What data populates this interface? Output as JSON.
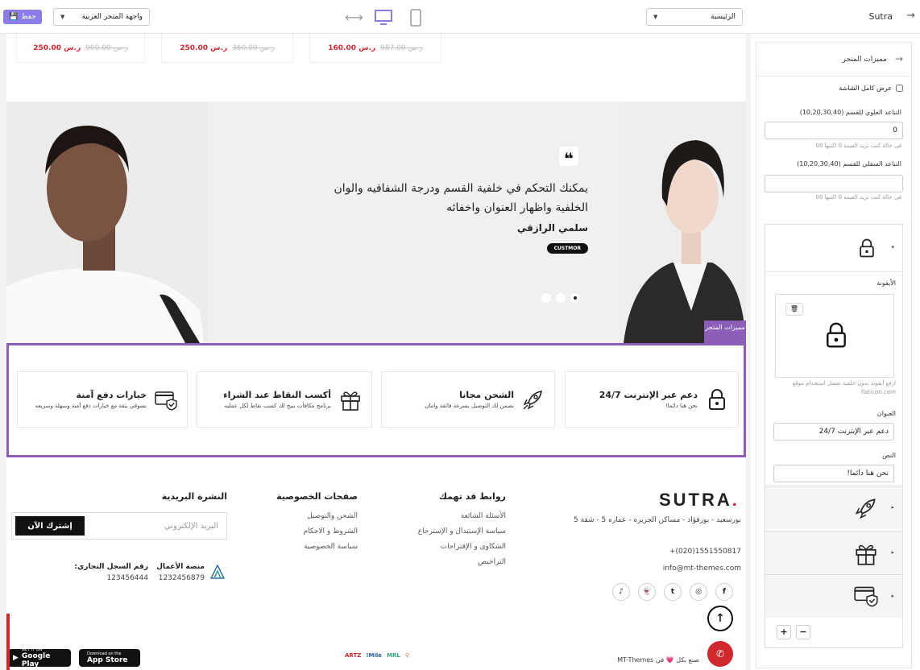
{
  "topbar": {
    "save_label": "حفظ",
    "theme_select": "واجهة المتجر العربية",
    "page_select": "الرئيسية",
    "brand": "Sutra"
  },
  "products": [
    {
      "price": "250.00 ر.س",
      "old": "900.00 ر.س"
    },
    {
      "price": "250.00 ر.س",
      "old": "360.00 ر.س"
    },
    {
      "price": "160.00 ر.س",
      "old": "987.00 ر.س"
    }
  ],
  "testimonial": {
    "quote": "يمكنك التحكم في خلفية القسم ودرجة الشفافيه والوان الخلفية واظهار العنوان واخفائه",
    "name": "سلمي الرازقي",
    "badge": "CUSTMOR",
    "tag": "مميزات المتجر"
  },
  "features": [
    {
      "title": "دعم عبر الإنترنت 24/7",
      "sub": "نحن هنا دائما!",
      "icon": "lock-icon"
    },
    {
      "title": "الشحن مجانا",
      "sub": "نضمن لك التوصيل بسرعة فائقة وامان",
      "icon": "rocket-icon"
    },
    {
      "title": "أكسب النقاط عند الشراء",
      "sub": "برنامج مكافأت بنيح لك كسب نقاط لكل عمليه",
      "icon": "gift-icon"
    },
    {
      "title": "خيارات دفع آمنة",
      "sub": "نسوقي بثقة مع خيارات دفع آمنة وسهلة وسريعه",
      "icon": "secure-card-icon"
    }
  ],
  "footer": {
    "logo": "SUTRA",
    "address": "بورسعيد - بورفؤاد - مساكن الجزيره - عماره 5 - شقة 5",
    "phone": "+(020)1551550817",
    "email": "info@mt-themes.com",
    "col1_title": "روابط قد تهمك",
    "col1_links": [
      "الأسئلة الشائعة",
      "سياسة الإستبدال و الإسترجاع",
      "الشكاوى و الإقتراحات",
      "التراخيص"
    ],
    "col2_title": "صفحات الخصوصية",
    "col2_links": [
      "الشحن والتوصيل",
      "الشروط و الاحكام",
      "سياسة الخصوصية"
    ],
    "newsletter_title": "النشرة البريدية",
    "newsletter_placeholder": "البريد الإلكتروني",
    "newsletter_button": "إشترك الآن",
    "platform_label": "منصة الأعمال",
    "platform_value": "1232456879",
    "cr_label": "رقم السجل التجاري:",
    "cr_value": "123456444",
    "made_by": "صنع بكل 💗 في MT-Themes",
    "google_small": "GET IT ON",
    "google_label": "Google Play",
    "apple_small": "Download on the",
    "apple_label": "App Store",
    "pay1": "ARTZ",
    "pay2": "!Mile",
    "pay3": "MRL"
  },
  "panel": {
    "title": "مميزات المتجر",
    "fullwidth_label": "عرض كامل الشاشة",
    "top_spacing_label": "التباعد العلوي للقسم (10,20,30,40)",
    "top_spacing_value": "0",
    "top_hint": "في حالة كنت تريد القيمة 0 اكتبها 00",
    "bottom_spacing_label": "التباعد السفلي للقسم (10,20,30,40)",
    "bottom_spacing_value": "",
    "bottom_hint": "في حالة كنت تريد القيمة 0 اكتبها 00",
    "icon_label": "الأيقونة",
    "icon_hint": "ارفع أيقونة بدون خلفية نفضل استخدام موقع flaticon.com",
    "heading_label": "العنوان",
    "heading_value": "دعم عبر الإنترنت 24/7",
    "text_label": "النص",
    "text_value": "نحن هنا دائما!"
  }
}
